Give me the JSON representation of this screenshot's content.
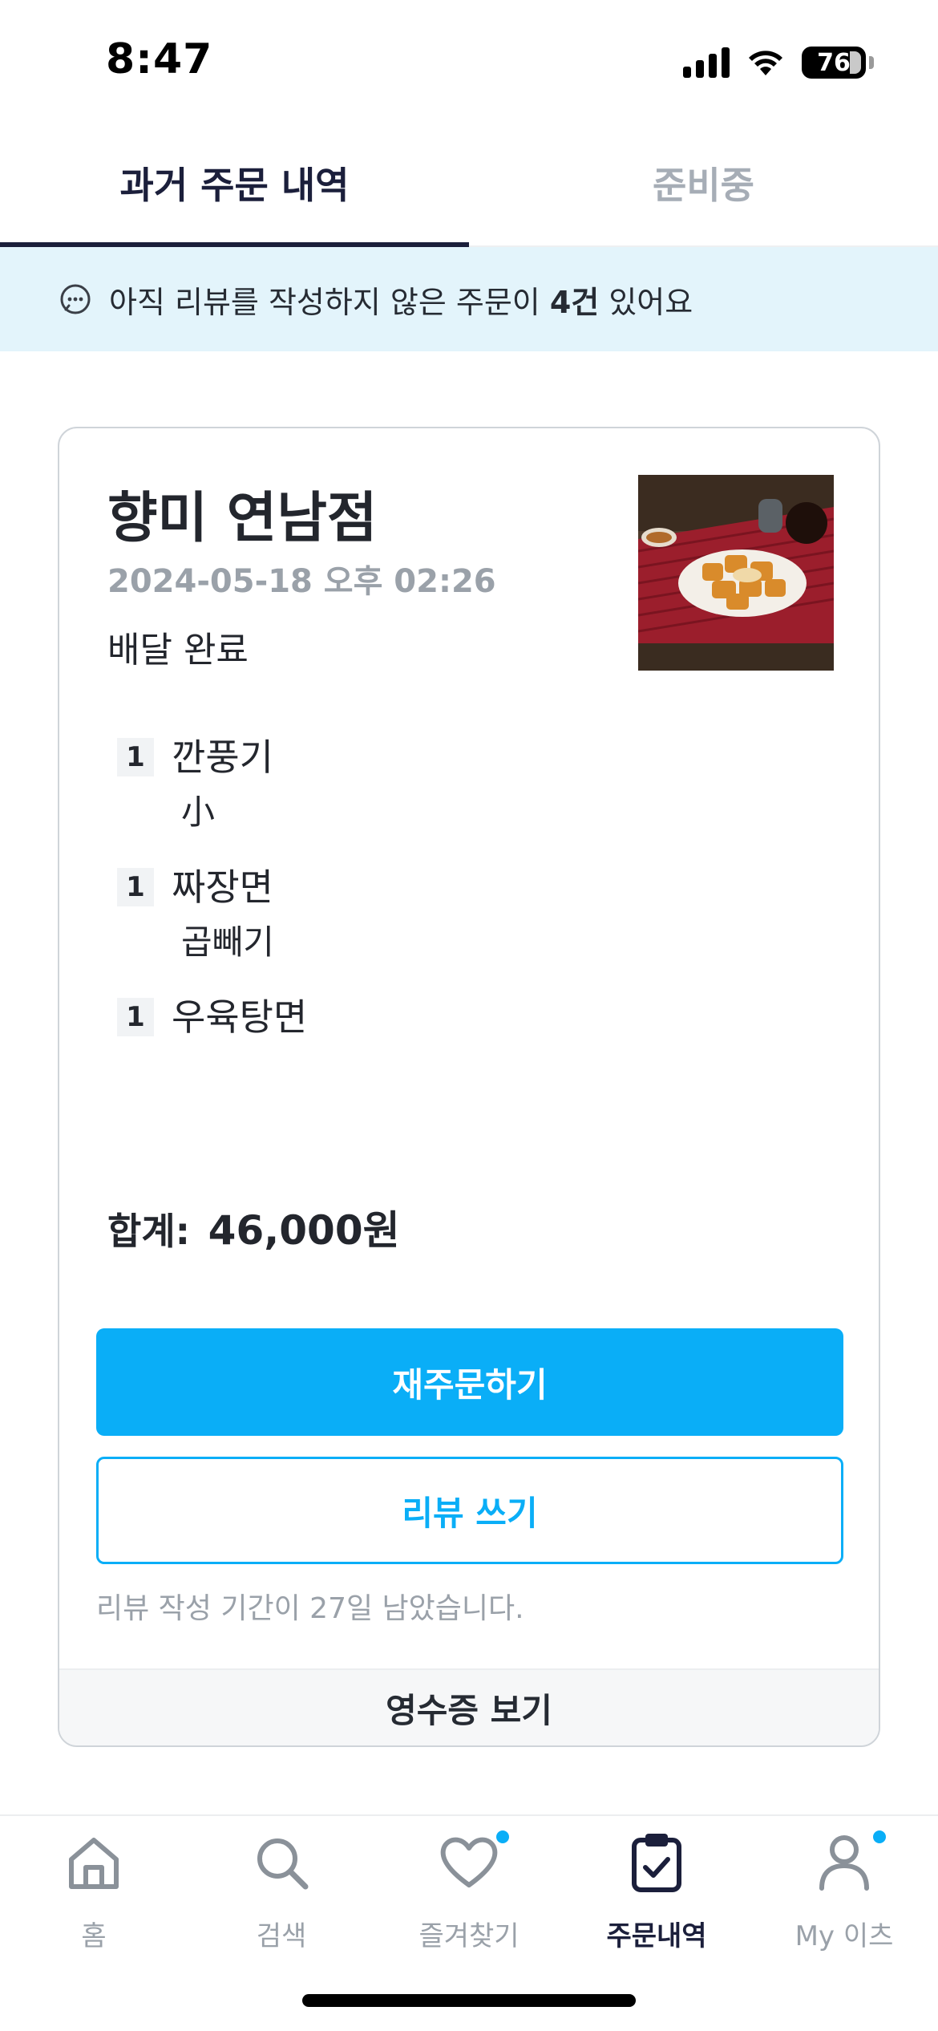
{
  "status_bar": {
    "time": "8:47",
    "battery": "76"
  },
  "tabs": [
    {
      "label": "과거 주문 내역",
      "active": true
    },
    {
      "label": "준비중",
      "active": false
    }
  ],
  "banner": {
    "text_before": "아직 리뷰를 작성하지 않은 주문이 ",
    "count": "4건",
    "text_after": " 있어요"
  },
  "order": {
    "store_name": "향미 연남점",
    "date": "2024-05-18 오후 02:26",
    "status": "배달 완료",
    "items": [
      {
        "qty": "1",
        "name": "깐풍기",
        "option": "小"
      },
      {
        "qty": "1",
        "name": "짜장면",
        "option": "곱빼기"
      },
      {
        "qty": "1",
        "name": "우육탕면",
        "option": ""
      }
    ],
    "total_label": "합계:",
    "total_value": "46,000원",
    "reorder_label": "재주문하기",
    "review_label": "리뷰 쓰기",
    "review_deadline": "리뷰 작성 기간이 27일 남았습니다.",
    "receipt_label": "영수증 보기"
  },
  "bottom_nav": [
    {
      "label": "홈",
      "icon": "home-icon",
      "active": false
    },
    {
      "label": "검색",
      "icon": "search-icon",
      "active": false
    },
    {
      "label": "즐겨찾기",
      "icon": "heart-icon",
      "active": false
    },
    {
      "label": "주문내역",
      "icon": "clipboard-check-icon",
      "active": true
    },
    {
      "label": "My 이츠",
      "icon": "person-icon",
      "active": false
    }
  ],
  "colors": {
    "accent": "#0aaef7",
    "dark": "#1b1f3b",
    "banner_bg": "#e3f4fb"
  }
}
